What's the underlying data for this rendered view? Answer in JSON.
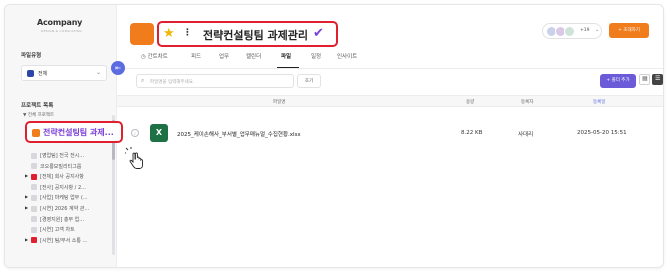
{
  "brand": {
    "name": "Acompany",
    "tagline": "DESIGN & CONSULTING"
  },
  "sidebar": {
    "file_type_label": "파일유형",
    "file_type_value": "전체",
    "project_list_label": "프로젝트 목록",
    "tree_root": "▼ 전체 프로젝트",
    "active_project": "전략컨설팅팀 과제...",
    "items": [
      {
        "label": "[영업팀] 전국 전시...",
        "color": "#d8d8dc",
        "caret": false
      },
      {
        "label": "코오롱모빌리티그룹",
        "color": "#d8d8dc",
        "caret": false
      },
      {
        "label": "[전체] 회사 공지사항",
        "color": "#e0202e",
        "caret": true
      },
      {
        "label": "[전사] 공지사항 / 2...",
        "color": "#d8d8dc",
        "caret": false
      },
      {
        "label": "[사업] 마케팅 업무 (...",
        "color": "#d8d8dc",
        "caret": true
      },
      {
        "label": "[시연] 2026 계약 관...",
        "color": "#d8d8dc",
        "caret": true
      },
      {
        "label": "[경영지원] 총무 업...",
        "color": "#d8d8dc",
        "caret": false
      },
      {
        "label": "[시연] 고객 차트",
        "color": "#d8d8dc",
        "caret": false
      },
      {
        "label": "[시연] 팀/부서 소통 ...",
        "color": "#e0202e",
        "caret": true
      }
    ]
  },
  "header": {
    "title": "전략컨설팅팀 과제관리",
    "member_count": "+19",
    "invite_label": "+ 초대하기"
  },
  "tabs": [
    "간트차트",
    "피드",
    "업무",
    "캘린더",
    "파일",
    "일정",
    "인사이트"
  ],
  "active_tab_index": 4,
  "toolbar": {
    "search_placeholder": "파일명을 입력해주세요.",
    "reset_label": "초기",
    "add_folder_label": "+ 폴더 추가"
  },
  "table": {
    "headers": {
      "name": "파일명",
      "size": "용량",
      "owner": "등록자",
      "date": "등록일"
    },
    "rows": [
      {
        "name": "2025_케이손해사_부서별_업무매뉴얼_수집현황.xlsx",
        "size": "8.22 KB",
        "owner": "사대리",
        "date": "2025-05-20 15:51"
      }
    ]
  },
  "colors": {
    "accent": "#f07c1c",
    "highlight": "#e0202e",
    "purple": "#7a3fd6",
    "excel": "#1e7145"
  },
  "icons": [
    "star-icon",
    "check-icon",
    "search-icon",
    "excel-icon",
    "grid-view-icon",
    "list-view-icon",
    "collapse-icon",
    "pointer-cursor-icon"
  ]
}
